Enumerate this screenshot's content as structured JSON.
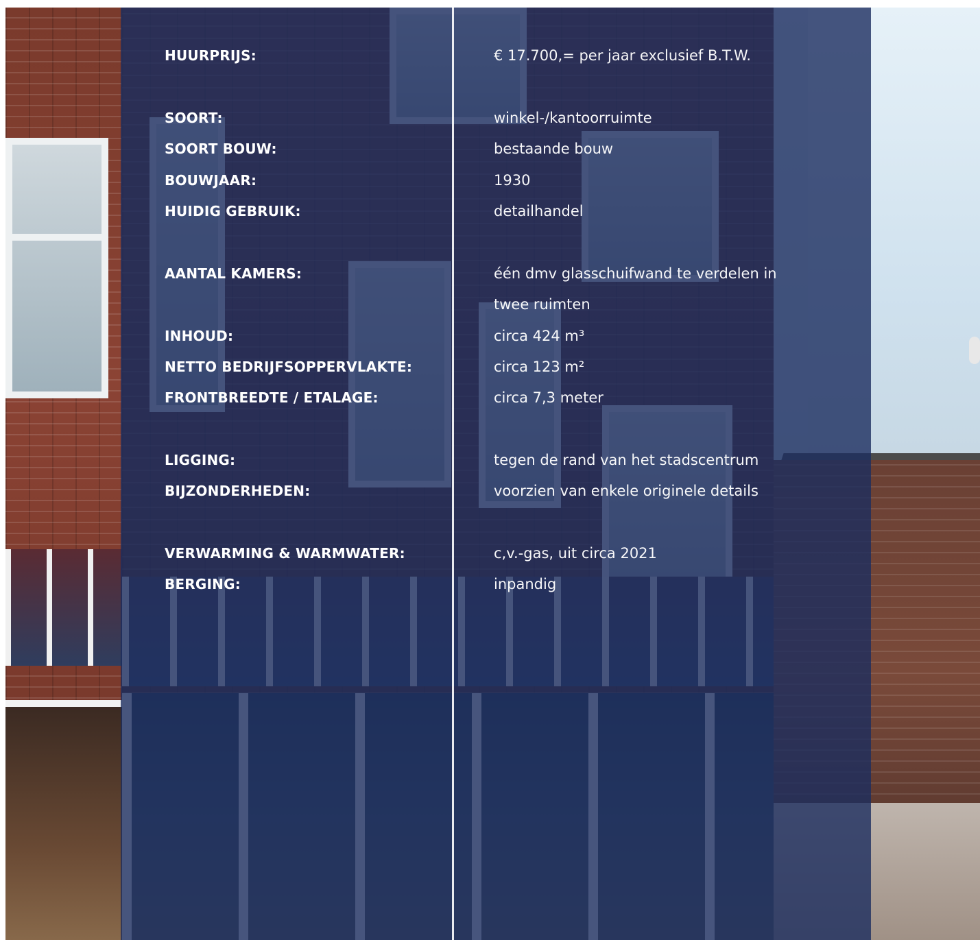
{
  "details": [
    {
      "label": "HUURPRIJS:",
      "value": "€  17.700,= per jaar exclusief B.T.W."
    },
    {
      "label": "SOORT:",
      "value": "winkel-/kantoorruimte"
    },
    {
      "label": "SOORT BOUW:",
      "value": "bestaande bouw"
    },
    {
      "label": "BOUWJAAR:",
      "value": "1930"
    },
    {
      "label": "HUIDIG GEBRUIK:",
      "value": "detailhandel"
    },
    {
      "label": "AANTAL KAMERS:",
      "value": "één dmv glasschuifwand te verdelen in",
      "value_line2": "twee ruimten"
    },
    {
      "label": "INHOUD:",
      "value": "circa 424 m³"
    },
    {
      "label": "NETTO BEDRIJFSOPPERVLAKTE:",
      "value": "circa 123 m²"
    },
    {
      "label": "FRONTBREEDTE / ETALAGE:",
      "value": "circa 7,3 meter"
    },
    {
      "label": "LIGGING:",
      "value": "tegen de rand van het stadscentrum"
    },
    {
      "label": "BIJZONDERHEDEN:",
      "value": "voorzien van enkele originele details"
    },
    {
      "label": "VERWARMING & WARMWATER:",
      "value": "c,v.-gas, uit circa 2021"
    },
    {
      "label": "BERGING:",
      "value": "inpandig"
    }
  ],
  "colors": {
    "overlay": "#1b2d5f",
    "text": "#ffffff"
  }
}
